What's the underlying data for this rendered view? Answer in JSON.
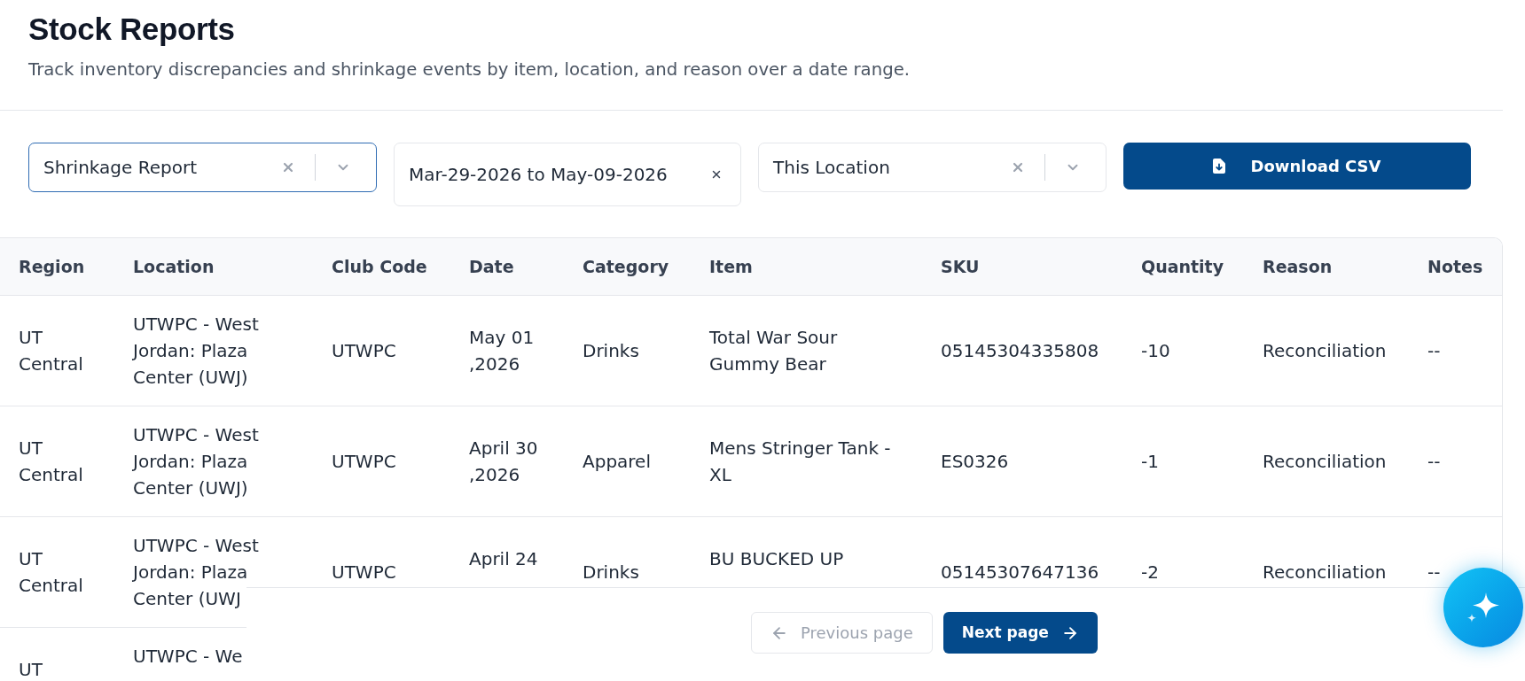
{
  "page": {
    "title": "Stock Reports",
    "subtitle": "Track inventory discrepancies and shrinkage events by item, location, and reason over a date range."
  },
  "filters": [
    {
      "kind": "select",
      "value": "Shrinkage Report",
      "focused": true
    },
    {
      "kind": "date_range",
      "value": "Mar-29-2026 to May-09-2026",
      "focused": false
    },
    {
      "kind": "select",
      "value": "This Location",
      "focused": false
    }
  ],
  "download_button": {
    "label": "Download CSV"
  },
  "table": {
    "columns": [
      "Region",
      "Location",
      "Club Code",
      "Date",
      "Category",
      "Item",
      "SKU",
      "Quantity",
      "Reason",
      "Notes"
    ],
    "rows": [
      [
        "UT Central",
        "UTWPC - West Jordan: Plaza Center (UWJ)",
        "UTWPC",
        "May 01 ,2026",
        "Drinks",
        "Total War Sour Gummy Bear",
        "05145304335808",
        "-10",
        "Reconciliation",
        "--"
      ],
      [
        "UT Central",
        "UTWPC - West Jordan: Plaza Center (UWJ)",
        "UTWPC",
        "April 30 ,2026",
        "Apparel",
        "Mens Stringer Tank - XL",
        "ES0326",
        "-1",
        "Reconciliation",
        "--"
      ],
      [
        "UT Central",
        "UTWPC - West Jordan: Plaza Center (UWJ",
        "UTWPC",
        "April 24",
        "Drinks",
        "BU BUCKED UP",
        "05145307647136",
        "-2",
        "Reconciliation",
        "--"
      ],
      [
        "UT",
        "UTWPC - We"
      ]
    ]
  },
  "pagination": {
    "previous": {
      "label": "Previous page",
      "disabled": true
    },
    "next": {
      "label": "Next page",
      "disabled": false
    }
  }
}
